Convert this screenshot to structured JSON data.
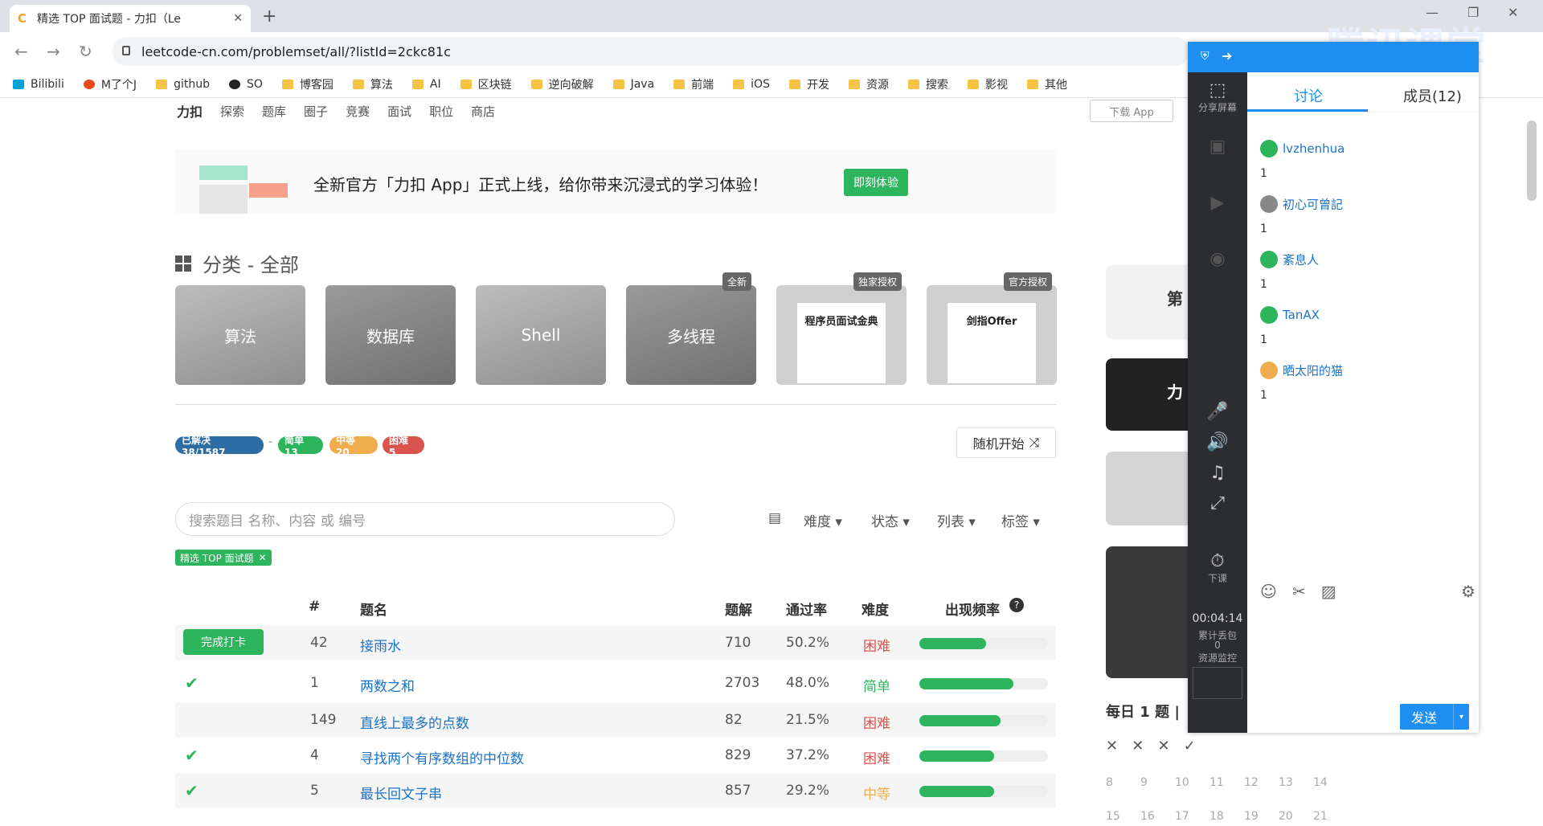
{
  "browser": {
    "tab_title": "精选 TOP 面试题 - 力扣（Le",
    "url": "leetcode-cn.com/problemset/all/?listId=2ckc81c",
    "bookmarks": [
      "Bilibili",
      "M了个J",
      "github",
      "SO",
      "博客园",
      "算法",
      "AI",
      "区块链",
      "逆向破解",
      "Java",
      "前端",
      "iOS",
      "开发",
      "资源",
      "搜索",
      "影视",
      "其他"
    ]
  },
  "site": {
    "logo": "力扣",
    "nav": [
      "探索",
      "题库",
      "圈子",
      "竞赛",
      "面试",
      "职位",
      "商店"
    ],
    "download_app": "下载 App",
    "promo_text": "全新官方「力扣 App」正式上线，给你带来沉浸式的学习体验！",
    "promo_button": "即刻体验",
    "category_title": "分类 - 全部",
    "cards": [
      {
        "label": "算法",
        "badge": ""
      },
      {
        "label": "数据库",
        "badge": ""
      },
      {
        "label": "Shell",
        "badge": ""
      },
      {
        "label": "多线程",
        "badge": "全新"
      },
      {
        "label": "程序员面试金典",
        "badge": "独家授权"
      },
      {
        "label": "剑指Offer",
        "badge": "官方授权"
      }
    ],
    "stats": {
      "solved": "已解决 38/1587",
      "easy": "简单 13",
      "medium": "中等 20",
      "hard": "困难 5"
    },
    "random_button": "随机开始",
    "search_placeholder": "搜索题目 名称、内容 或 编号",
    "filters": [
      "难度",
      "状态",
      "列表",
      "标签"
    ],
    "active_tag": "精选 TOP 面试题",
    "columns": [
      "#",
      "题名",
      "题解",
      "通过率",
      "难度",
      "出现频率"
    ],
    "checkin_label": "完成打卡",
    "problems": [
      {
        "status": "checkin",
        "id": "42",
        "name": "接雨水",
        "solutions": "710",
        "rate": "50.2%",
        "difficulty": "困难",
        "freq": 0.52
      },
      {
        "status": "done",
        "id": "1",
        "name": "两数之和",
        "solutions": "2703",
        "rate": "48.0%",
        "difficulty": "简单",
        "freq": 0.73
      },
      {
        "status": "",
        "id": "149",
        "name": "直线上最多的点数",
        "solutions": "82",
        "rate": "21.5%",
        "difficulty": "困难",
        "freq": 0.63
      },
      {
        "status": "done",
        "id": "4",
        "name": "寻找两个有序数组的中位数",
        "solutions": "829",
        "rate": "37.2%",
        "difficulty": "困难",
        "freq": 0.58
      },
      {
        "status": "done",
        "id": "5",
        "name": "最长回文子串",
        "solutions": "857",
        "rate": "29.2%",
        "difficulty": "中等",
        "freq": 0.58
      }
    ],
    "daily_label": "每日 1 题 |",
    "calendar": [
      "8",
      "9",
      "10",
      "11",
      "12",
      "13",
      "14",
      "15",
      "16",
      "17",
      "18",
      "19",
      "20",
      "21"
    ]
  },
  "tencent": {
    "watermark": "腾讯课堂",
    "tabs": [
      "讨论",
      "成员(12)"
    ],
    "share_label": "分享屏幕",
    "end_label": "下课",
    "timer": "00:04:14",
    "loss_label": "累计丢包",
    "loss_value": "0",
    "monitor_label": "资源监控",
    "messages": [
      {
        "user": "lvzhenhua",
        "text": "1"
      },
      {
        "user": "初心可曾記",
        "text": "1"
      },
      {
        "user": "紊息人",
        "text": "1"
      },
      {
        "user": "TanAX",
        "text": "1"
      },
      {
        "user": "晒太阳的猫",
        "text": "1"
      }
    ],
    "send_label": "发送"
  }
}
